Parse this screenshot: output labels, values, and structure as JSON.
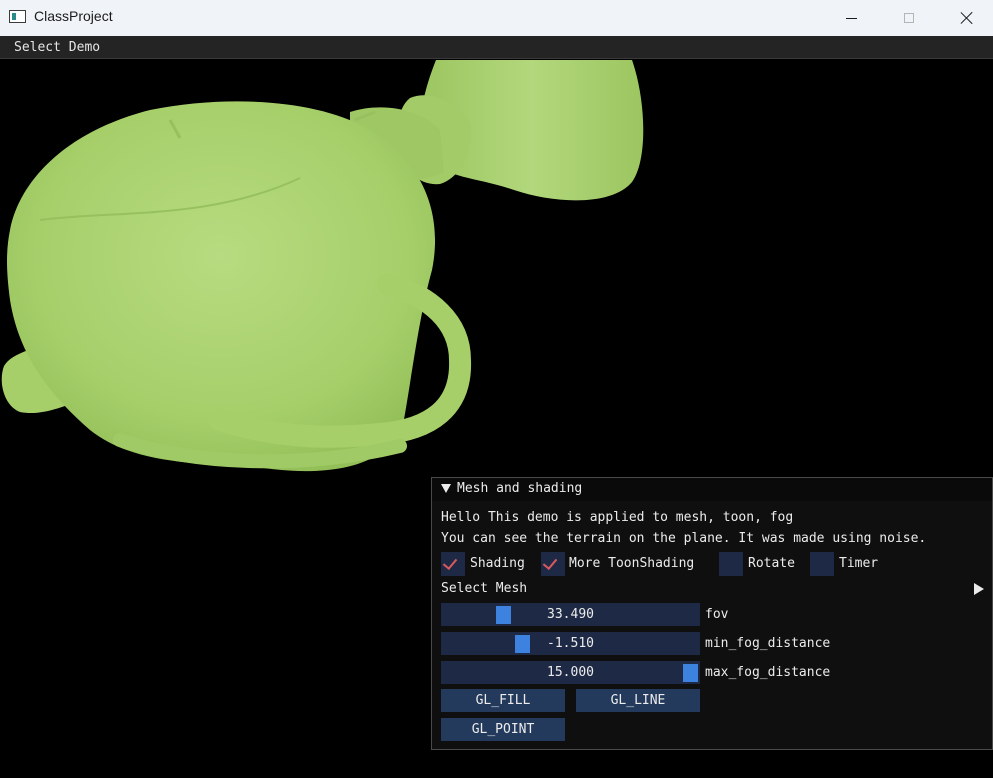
{
  "window": {
    "title": "ClassProject",
    "app_icon": "app-window-icon",
    "controls": [
      "minimize-icon",
      "maximize-icon",
      "close-icon"
    ]
  },
  "menubar": {
    "items": [
      {
        "label": "Select Demo"
      }
    ]
  },
  "viewport": {
    "background": "#000000",
    "mesh_color": "#a6cf6a"
  },
  "panel": {
    "title": "Mesh and shading",
    "expanded": true,
    "lines": [
      "Hello This demo is applied to mesh, toon, fog",
      "You can see the terrain on the plane. It was made using noise."
    ],
    "checkboxes": [
      {
        "label": "Shading",
        "checked": true
      },
      {
        "label": "More ToonShading",
        "checked": true
      },
      {
        "label": "Rotate",
        "checked": false
      },
      {
        "label": "Timer",
        "checked": false
      }
    ],
    "select_mesh_label": "Select Mesh",
    "sliders": [
      {
        "label": "fov",
        "value": "33.490",
        "fraction": 0.22
      },
      {
        "label": "min_fog_distance",
        "value": "-1.510",
        "fraction": 0.3
      },
      {
        "label": "max_fog_distance",
        "value": "15.000",
        "fraction": 1.0
      }
    ],
    "buttons": [
      "GL_FILL",
      "GL_LINE",
      "GL_POINT"
    ]
  },
  "colors": {
    "frame_bg": "#1e2a45",
    "slider_grab": "#3e82e0",
    "button_bg": "#233a5c",
    "check_mark": "#d9595e"
  }
}
